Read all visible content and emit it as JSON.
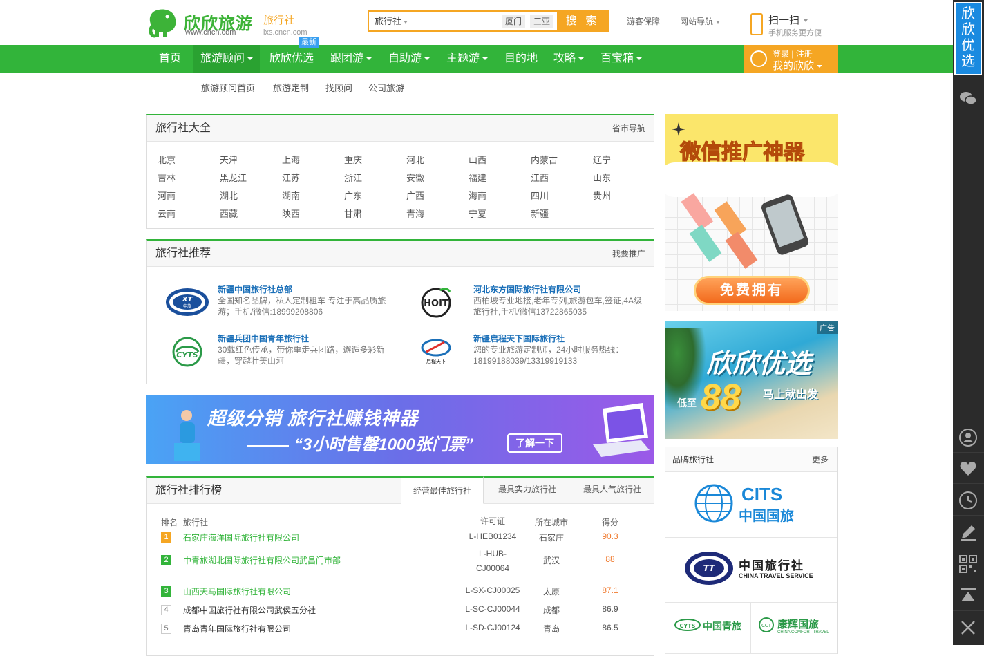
{
  "header": {
    "brand": "欣欣旅游",
    "brand_url": "www.cncn.com",
    "sub_title": "旅行社",
    "sub_url": "lxs.cncn.com",
    "search": {
      "category": "旅行社",
      "placeholder": "",
      "hot1": "厦门",
      "hot2": "三亚",
      "button": "搜 索"
    },
    "link_guarantee": "游客保障",
    "link_sitenav": "网站导航",
    "scan_title": "扫一扫",
    "scan_sub": "手机服务更方便"
  },
  "nav": {
    "items": [
      "首页",
      "旅游顾问",
      "欣欣优选",
      "跟团游",
      "自助游",
      "主题游",
      "目的地",
      "攻略",
      "百宝箱"
    ],
    "new_badge": "最新",
    "login_text": "登录 | 注册",
    "my_text": "我的欣欣"
  },
  "subnav": [
    "旅游顾问首页",
    "旅游定制",
    "找顾问",
    "公司旅游"
  ],
  "directory": {
    "title": "旅行社大全",
    "more": "省市导航",
    "provinces": [
      "北京",
      "天津",
      "上海",
      "重庆",
      "河北",
      "山西",
      "内蒙古",
      "辽宁",
      "吉林",
      "黑龙江",
      "江苏",
      "浙江",
      "安徽",
      "福建",
      "江西",
      "山东",
      "河南",
      "湖北",
      "湖南",
      "广东",
      "广西",
      "海南",
      "四川",
      "贵州",
      "云南",
      "西藏",
      "陕西",
      "甘肃",
      "青海",
      "宁夏",
      "新疆"
    ]
  },
  "recommend": {
    "title": "旅行社推荐",
    "more": "我要推广",
    "items": [
      {
        "name": "新疆中国旅行社总部",
        "desc": "全国知名品牌，私人定制租车 专注于高品质旅游；手机/微信:18999208806",
        "logo": "xt-logo"
      },
      {
        "name": "河北东方国际旅行社有限公司",
        "desc": "西柏坡专业地接,老年专列,旅游包车,签证,4A级旅行社,手机/微信13722865035",
        "logo": "choit-logo"
      },
      {
        "name": "新疆兵团中国青年旅行社",
        "desc": "30载红色传承，带你重走兵团路，邂逅多彩新疆，穿越壮美山河",
        "logo": "cyts-logo"
      },
      {
        "name": "新疆启程天下国际旅行社",
        "desc": "您的专业旅游定制师，24小时服务热线：18199188039/13319919133",
        "logo": "qicheng-logo"
      }
    ]
  },
  "banner": {
    "line1": "超级分销   旅行社赚钱神器",
    "line2": "“3小时售罄1000张门票”",
    "button": "了解一下"
  },
  "ranking": {
    "title": "旅行社排行榜",
    "tabs": [
      "经营最佳旅行社",
      "最具实力旅行社",
      "最具人气旅行社"
    ],
    "columns": [
      "排名",
      "旅行社",
      "许可证",
      "所在城市",
      "得分"
    ],
    "rows": [
      {
        "rank": "1",
        "name": "石家庄海洋国际旅行社有限公司",
        "license": "L-HEB01234",
        "city": "石家庄",
        "score": "90.3"
      },
      {
        "rank": "2",
        "name": "中青旅湖北国际旅行社有限公司武昌门市部",
        "license": "L-HUB-CJ00064",
        "city": "武汉",
        "score": "88"
      },
      {
        "rank": "3",
        "name": "山西天马国际旅行社有限公司",
        "license": "L-SX-CJ00025",
        "city": "太原",
        "score": "87.1"
      },
      {
        "rank": "4",
        "name": "成都中国旅行社有限公司武侯五分社",
        "license": "L-SC-CJ00044",
        "city": "成都",
        "score": "86.9"
      },
      {
        "rank": "5",
        "name": "青岛青年国际旅行社有限公司",
        "license": "L-SD-CJ00124",
        "city": "青岛",
        "score": "86.5"
      }
    ]
  },
  "ads": {
    "wechat_title": "微信推广神器",
    "wechat_button": "免费拥有",
    "youxuan_tag": "广告",
    "youxuan_title": "欣欣优选",
    "youxuan_prefix": "低至",
    "youxuan_price": "88",
    "youxuan_suffix": "马上就出发"
  },
  "brands": {
    "title": "品牌旅行社",
    "more": "更多",
    "items": [
      {
        "name": "CITS 中国国旅"
      },
      {
        "name": "中国旅行社",
        "en": "CHINA TRAVEL SERVICE"
      },
      {
        "name": "中国青旅"
      },
      {
        "name": "康辉国旅",
        "en": "CHINA COMFORT TRAVEL"
      }
    ]
  },
  "sidebar": {
    "promo": "欣欣优选",
    "icons": [
      "wechat-icon",
      "user-icon",
      "heart-icon",
      "clock-icon",
      "edit-icon",
      "qrcode-icon",
      "top-icon",
      "close-icon"
    ]
  },
  "colors": {
    "green": "#32b43a",
    "orange": "#f5a623",
    "blue_link": "#1a6fb8",
    "sidebar": "#2b2b2b"
  }
}
